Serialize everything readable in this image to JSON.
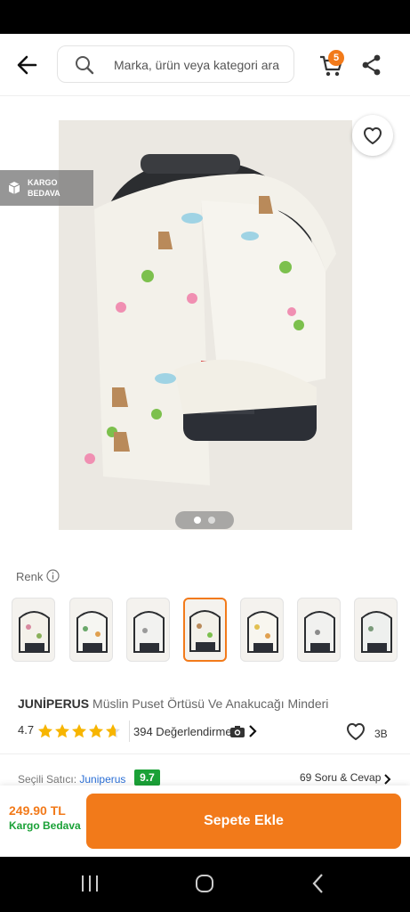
{
  "header": {
    "search_placeholder": "Marka, ürün veya kategori ara",
    "cart_count": "5",
    "icons": [
      "back-arrow-icon",
      "search-icon",
      "cart-icon",
      "share-icon"
    ]
  },
  "gallery": {
    "badge_line1": "KARGO",
    "badge_line2": "BEDAVA",
    "current_page": 1,
    "page_count": 2,
    "icons": [
      "heart-icon",
      "box-icon"
    ]
  },
  "variants": {
    "label": "Renk",
    "selected_index": 3,
    "count": 7
  },
  "product": {
    "brand": "JUNİPERUS",
    "name": "Müslin Puset Örtüsü Ve Anakucağı Minderi",
    "rating": "4.7",
    "rating_value": 4.7,
    "reviews_text": "394 Değerlendirme",
    "like_count": "3B"
  },
  "seller": {
    "label": "Seçili Satıcı:",
    "name": "Juniperus",
    "score": "9.7",
    "qa_text": "69 Soru & Cevap"
  },
  "bottom": {
    "price": "249.90 TL",
    "shipping": "Kargo Bedava",
    "add_to_cart": "Sepete Ekle"
  },
  "colors": {
    "accent": "#f27a1a",
    "green": "#1aa137",
    "link": "#2b6fd6"
  }
}
